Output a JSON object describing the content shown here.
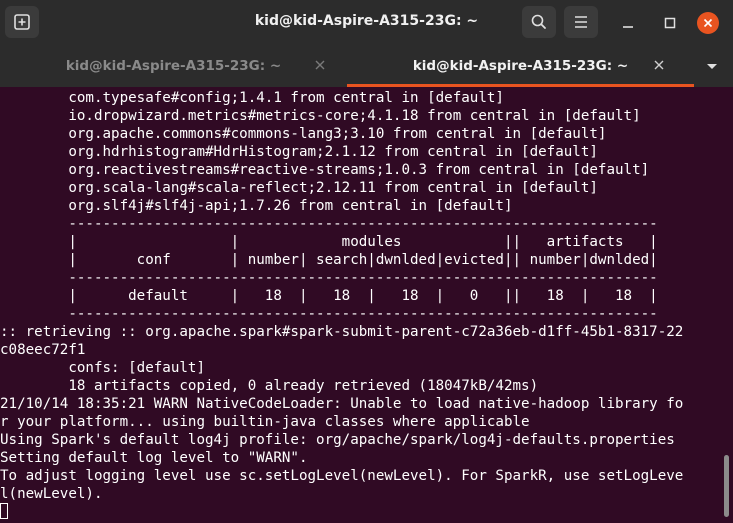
{
  "window": {
    "title": "kid@kid-Aspire-A315-23G: ~"
  },
  "tabs": [
    {
      "label": "kid@kid-Aspire-A315-23G: ~",
      "active": false
    },
    {
      "label": "kid@kid-Aspire-A315-23G: ~",
      "active": true
    }
  ],
  "icons": {
    "new_tab": "new-tab-icon",
    "search": "search-icon",
    "menu": "hamburger-menu-icon",
    "minimize": "minimize-icon",
    "maximize": "maximize-icon",
    "close": "close-icon",
    "tab_close": "close-icon",
    "tab_dropdown": "chevron-down-icon"
  },
  "colors": {
    "terminal_bg": "#300a24",
    "terminal_fg": "#ffffff",
    "accent": "#e95420",
    "chrome_bg": "#2c2c2c"
  },
  "terminal": {
    "lines": [
      "        com.typesafe#config;1.4.1 from central in [default]",
      "        io.dropwizard.metrics#metrics-core;4.1.18 from central in [default]",
      "        org.apache.commons#commons-lang3;3.10 from central in [default]",
      "        org.hdrhistogram#HdrHistogram;2.1.12 from central in [default]",
      "        org.reactivestreams#reactive-streams;1.0.3 from central in [default]",
      "        org.scala-lang#scala-reflect;2.12.11 from central in [default]",
      "        org.slf4j#slf4j-api;1.7.26 from central in [default]",
      "        ---------------------------------------------------------------------",
      "        |                  |            modules            ||   artifacts   |",
      "        |       conf       | number| search|dwnlded|evicted|| number|dwnlded|",
      "        ---------------------------------------------------------------------",
      "        |      default     |   18  |   18  |   18  |   0   ||   18  |   18  |",
      "        ---------------------------------------------------------------------",
      ":: retrieving :: org.apache.spark#spark-submit-parent-c72a36eb-d1ff-45b1-8317-22",
      "c08eec72f1",
      "        confs: [default]",
      "        18 artifacts copied, 0 already retrieved (18047kB/42ms)",
      "21/10/14 18:35:21 WARN NativeCodeLoader: Unable to load native-hadoop library fo",
      "r your platform... using builtin-java classes where applicable",
      "Using Spark's default log4j profile: org/apache/spark/log4j-defaults.properties",
      "Setting default log level to \"WARN\".",
      "To adjust logging level use sc.setLogLevel(newLevel). For SparkR, use setLogLeve",
      "l(newLevel)."
    ]
  }
}
